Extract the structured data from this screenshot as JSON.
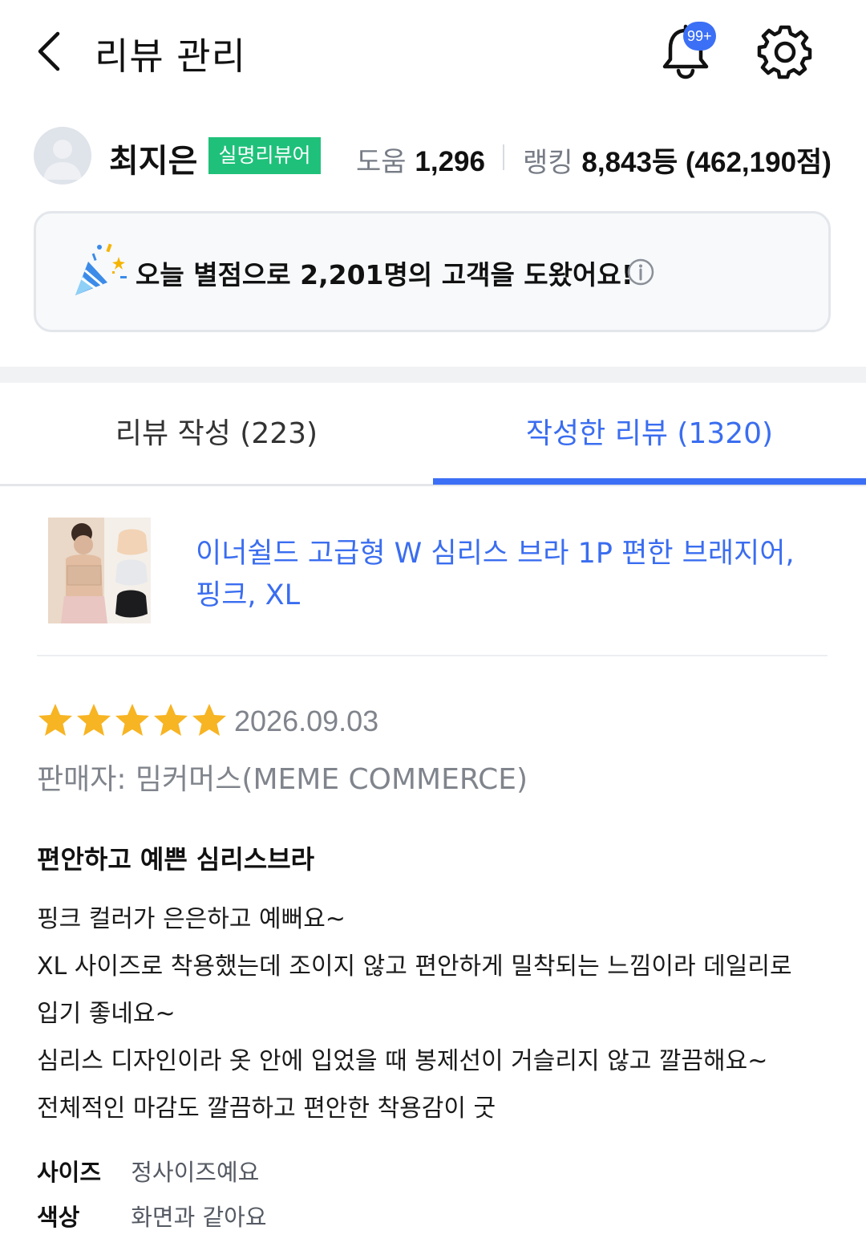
{
  "header": {
    "title": "리뷰 관리",
    "notification_badge": "99+"
  },
  "profile": {
    "name": "최지은",
    "badge": "실명리뷰어",
    "help_label": "도움",
    "help_count": "1,296",
    "rank_label": "랭킹",
    "rank_value": "8,843등 (462,190점)"
  },
  "banner": {
    "text": "오늘 별점으로 2,201명의 고객을 도왔어요!"
  },
  "tabs": [
    {
      "label": "리뷰 작성 (223)",
      "active": false
    },
    {
      "label": "작성한 리뷰 (1320)",
      "active": true
    }
  ],
  "product": {
    "name": "이너쉴드 고급형 W 심리스 브라 1P 편한 브래지어, 핑크, XL"
  },
  "review": {
    "rating": 5,
    "rating_max": 5,
    "date": "2026.09.03",
    "seller": "판매자: 밈커머스(MEME COMMERCE)",
    "title": "편안하고 예쁜 심리스브라",
    "body_lines": [
      "핑크 컬러가 은은하고 예뻐요~",
      "XL 사이즈로 착용했는데 조이지 않고 편안하게 밀착되는 느낌이라 데일리로",
      "입기 좋네요~",
      "심리스 디자인이라 옷 안에 입었을 때 봉제선이 거슬리지 않고 깔끔해요~",
      "전체적인 마감도 깔끔하고 편안한 착용감이 굿"
    ],
    "attributes": [
      {
        "key": "사이즈",
        "value": "정사이즈예요"
      },
      {
        "key": "색상",
        "value": "화면과 같아요"
      }
    ]
  },
  "colors": {
    "accent_blue": "#3b6ff5",
    "badge_green": "#1fc17a",
    "star_yellow": "#f7b423"
  }
}
